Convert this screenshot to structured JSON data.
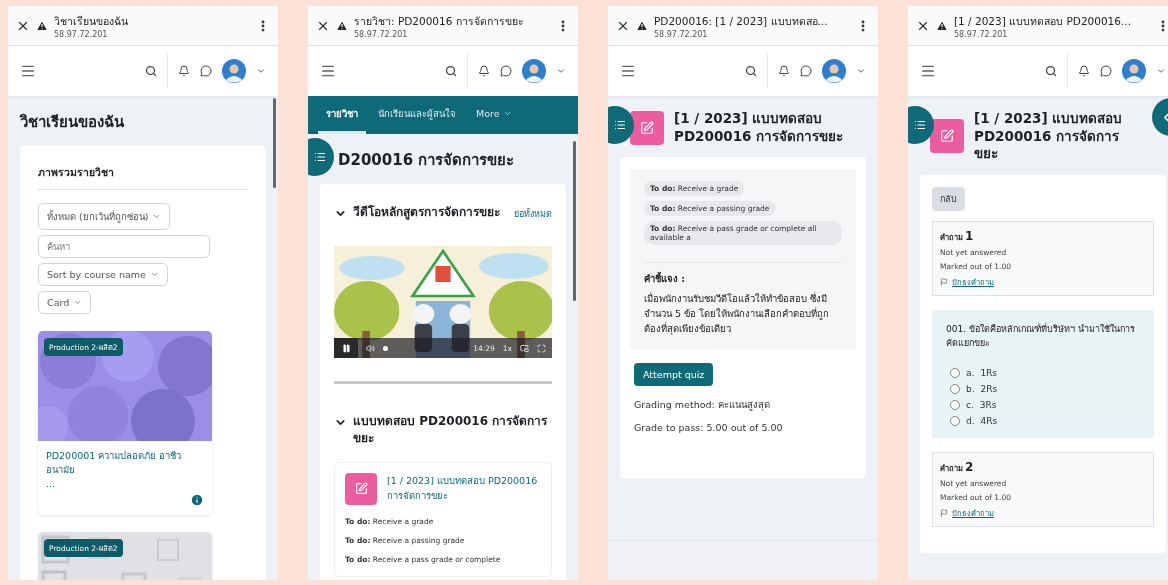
{
  "screens": [
    {
      "kind": "dashboard",
      "browser": {
        "title": "วิชาเรียนของฉัน",
        "url": "58.97.72.201"
      },
      "heading": "วิชาเรียนของฉัน",
      "overview": {
        "title": "ภาพรวมรายวิชา",
        "filters": [
          {
            "kind": "select",
            "label": "ทั้งหมด (ยกเว้นที่ถูกซ่อน)"
          },
          {
            "kind": "search",
            "placeholder": "ค้นหา"
          },
          {
            "kind": "select",
            "label": "Sort by course name"
          },
          {
            "kind": "select",
            "label": "Card"
          }
        ],
        "courses": [
          {
            "category": "Production 2-ผลิต2",
            "title": "PD200001 ความปลอดภัย อาชีวอนามัย",
            "ellipsis": "..."
          },
          {
            "category": "Production 2-ผลิต2"
          }
        ]
      }
    },
    {
      "kind": "course",
      "browser": {
        "title": "รายวิชา: PD200016 การจัดการขยะ",
        "url": "58.97.72.201"
      },
      "tabs": [
        {
          "label": "รายวิชา",
          "selected": true
        },
        {
          "label": "นักเรียนและผู้สนใจ",
          "selected": false
        },
        {
          "label": "More",
          "selected": false
        }
      ],
      "heading": "D200016 การจัดการขยะ",
      "sections": [
        {
          "title": "วีดีโอหลักสูตรการจัดการขยะ",
          "action": "ย่อทั้งหมด",
          "video": {
            "time": "14:29",
            "speed": "1x"
          }
        },
        {
          "title": "แบบทดสอบ PD200016 การจัดการขยะ",
          "activity": {
            "title": "[1 / 2023] แบบทดสอบ PD200016 การจัดการขยะ",
            "todos": [
              "**To do:** Receive a grade",
              "**To do:** Receive a passing grade",
              "**To do:** Receive a pass grade or complete"
            ]
          }
        }
      ]
    },
    {
      "kind": "quiz",
      "browser": {
        "title": "PD200016: [1 / 2023] แบบทดสอ...",
        "url": "58.97.72.201"
      },
      "heading": "[1 / 2023] แบบทดสอบ PD200016 การจัดการขยะ",
      "todos": [
        "**To do:** Receive a grade",
        "**To do:** Receive a passing grade",
        "**To do:** Receive a pass grade or complete all available a"
      ],
      "instructions": {
        "title": "คำชี้แจง :",
        "text": "เมื่อพนักงานรับชมวีดีโอแล้วให้ทำข้อสอบ ซึ่งมีจำนวน 5 ข้อ โดยให้พนักงานเลือกคำตอบที่ถูกต้องที่สุดเพียงข้อเดียว"
      },
      "button": "Attempt quiz",
      "details": [
        "Grading method: คะแนนสูงสุด",
        "Grade to pass: 5.00 out of 5.00"
      ]
    },
    {
      "kind": "attempt",
      "browser": {
        "title": "[1 / 2023] แบบทดสอบ PD200016...",
        "url": "58.97.72.201"
      },
      "heading": "[1 / 2023] แบบทดสอบ PD200016 การจัดการขยะ",
      "back": "กลับ",
      "questions": [
        {
          "label": "คำถาม",
          "number": "1",
          "status": "Not yet answered",
          "marks": "Marked out of 1.00",
          "flag": "ปักธงคำถาม",
          "text": "001. ข้อใดคือหลักเกณฑ์ที่บริษัทฯ นำมาใช้ในการคัดแยกขยะ",
          "options": [
            {
              "letter": "a.",
              "text": "1Rs",
              "selected": false
            },
            {
              "letter": "b.",
              "text": "2Rs",
              "selected": false
            },
            {
              "letter": "c.",
              "text": "3Rs",
              "selected": false
            },
            {
              "letter": "d.",
              "text": "4Rs",
              "selected": false
            }
          ]
        },
        {
          "label": "คำถาม",
          "number": "2",
          "status": "Not yet answered",
          "marks": "Marked out of 1.00",
          "flag": "ปักธงคำถาม"
        }
      ]
    }
  ]
}
